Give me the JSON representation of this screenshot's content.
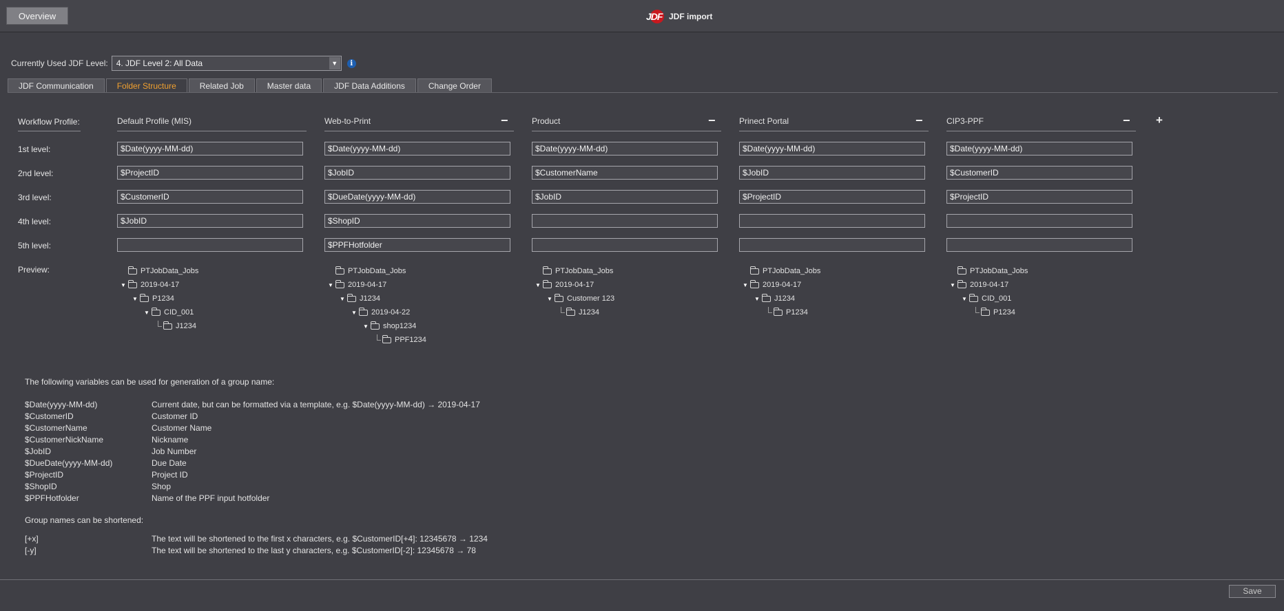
{
  "header": {
    "overview_label": "Overview",
    "logo_text": "JDF",
    "title": "JDF import"
  },
  "level": {
    "label": "Currently Used JDF Level:",
    "selected": "4. JDF Level 2: All Data",
    "info_glyph": "i"
  },
  "tabs": [
    {
      "label": "JDF Communication"
    },
    {
      "label": "Folder Structure",
      "active": true
    },
    {
      "label": "Related Job"
    },
    {
      "label": "Master data"
    },
    {
      "label": "JDF Data Additions"
    },
    {
      "label": "Change Order"
    }
  ],
  "rows": {
    "workflow_profile": "Workflow Profile:",
    "level1": "1st level:",
    "level2": "2nd level:",
    "level3": "3rd level:",
    "level4": "4th level:",
    "level5": "5th level:",
    "preview": "Preview:"
  },
  "profiles": [
    {
      "name": "Default Profile (MIS)",
      "levels": [
        "$Date(yyyy-MM-dd)",
        "$ProjectID",
        "$CustomerID",
        "$JobID",
        ""
      ],
      "preview": [
        "PTJobData_Jobs",
        "2019-04-17",
        "P1234",
        "CID_001",
        "J1234"
      ]
    },
    {
      "name": "Web-to-Print",
      "levels": [
        "$Date(yyyy-MM-dd)",
        "$JobID",
        "$DueDate(yyyy-MM-dd)",
        "$ShopID",
        "$PPFHotfolder"
      ],
      "preview": [
        "PTJobData_Jobs",
        "2019-04-17",
        "J1234",
        "2019-04-22",
        "shop1234",
        "PPF1234"
      ]
    },
    {
      "name": "Product",
      "levels": [
        "$Date(yyyy-MM-dd)",
        "$CustomerName",
        "$JobID",
        "",
        ""
      ],
      "preview": [
        "PTJobData_Jobs",
        "2019-04-17",
        "Customer 123",
        "J1234"
      ]
    },
    {
      "name": "Prinect Portal",
      "levels": [
        "$Date(yyyy-MM-dd)",
        "$JobID",
        "$ProjectID",
        "",
        ""
      ],
      "preview": [
        "PTJobData_Jobs",
        "2019-04-17",
        "J1234",
        "P1234"
      ]
    },
    {
      "name": "CIP3-PPF",
      "levels": [
        "$Date(yyyy-MM-dd)",
        "$CustomerID",
        "$ProjectID",
        "",
        ""
      ],
      "preview": [
        "PTJobData_Jobs",
        "2019-04-17",
        "CID_001",
        "P1234"
      ]
    }
  ],
  "controls": {
    "minus": "−",
    "plus": "+"
  },
  "help": {
    "title": "The following variables can be used for generation of a group name:",
    "variables": [
      {
        "var": "$Date(yyyy-MM-dd)",
        "desc": "Current date, but can be formatted via a template, e.g. $Date(yyyy-MM-dd)  →  2019-04-17"
      },
      {
        "var": "$CustomerID",
        "desc": "Customer ID"
      },
      {
        "var": "$CustomerName",
        "desc": "Customer Name"
      },
      {
        "var": "$CustomerNickName",
        "desc": "Nickname"
      },
      {
        "var": "$JobID",
        "desc": "Job Number"
      },
      {
        "var": "$DueDate(yyyy-MM-dd)",
        "desc": "Due Date"
      },
      {
        "var": "$ProjectID",
        "desc": "Project ID"
      },
      {
        "var": "$ShopID",
        "desc": "Shop"
      },
      {
        "var": "$PPFHotfolder",
        "desc": "Name of the PPF input hotfolder"
      }
    ],
    "shorten_title": "Group names can be shortened:",
    "shorten": [
      {
        "var": "[+x]",
        "desc": "The text will be shortened to the first x characters, e.g. $CustomerID[+4]: 12345678 → 1234"
      },
      {
        "var": "[-y]",
        "desc": "The text will be shortened to the last y characters, e.g. $CustomerID[-2]: 12345678 → 78"
      }
    ]
  },
  "footer": {
    "save_label": "Save"
  }
}
